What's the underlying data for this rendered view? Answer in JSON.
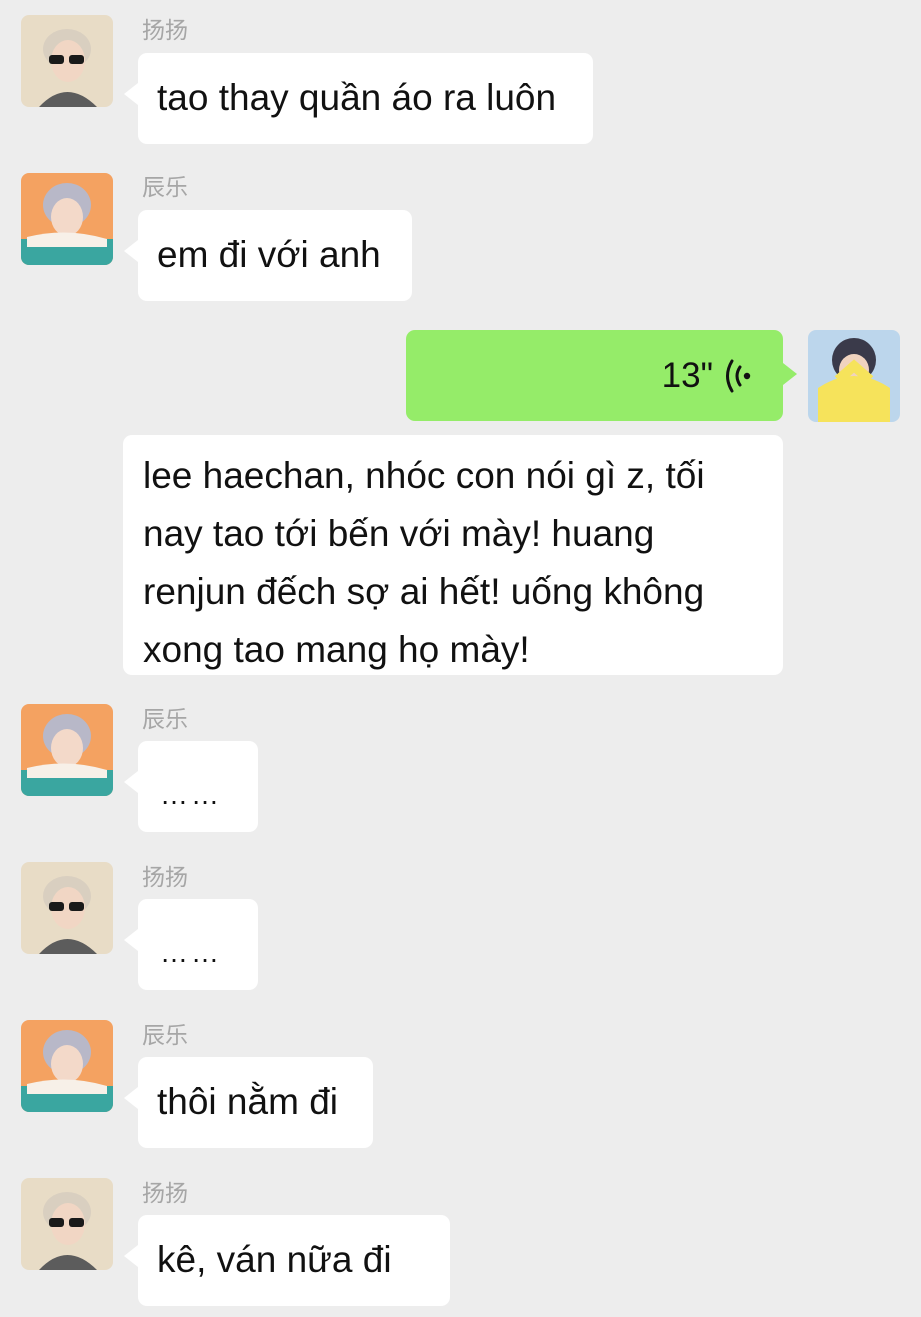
{
  "messages": [
    {
      "sender": "扬扬",
      "text": "tao thay quần áo ra luôn"
    },
    {
      "sender": "辰乐",
      "text": "em đi với anh"
    },
    {
      "voice_duration": "13\""
    },
    {
      "lines": [
        "lee haechan, nhóc con nói gì z, tối",
        "nay tao tới bến với mày! huang",
        "renjun đếch sợ ai hết! uống không",
        "xong tao mang họ mày!"
      ]
    },
    {
      "sender": "辰乐",
      "text": "……"
    },
    {
      "sender": "扬扬",
      "text": "……"
    },
    {
      "sender": "辰乐",
      "text": "thôi nằm đi"
    },
    {
      "sender": "扬扬",
      "text": "kê, ván nữa đi"
    }
  ],
  "colors": {
    "background": "#ededed",
    "bubble_incoming": "#ffffff",
    "bubble_outgoing": "#95ec69"
  },
  "icons": [
    "voice-wave-icon"
  ]
}
